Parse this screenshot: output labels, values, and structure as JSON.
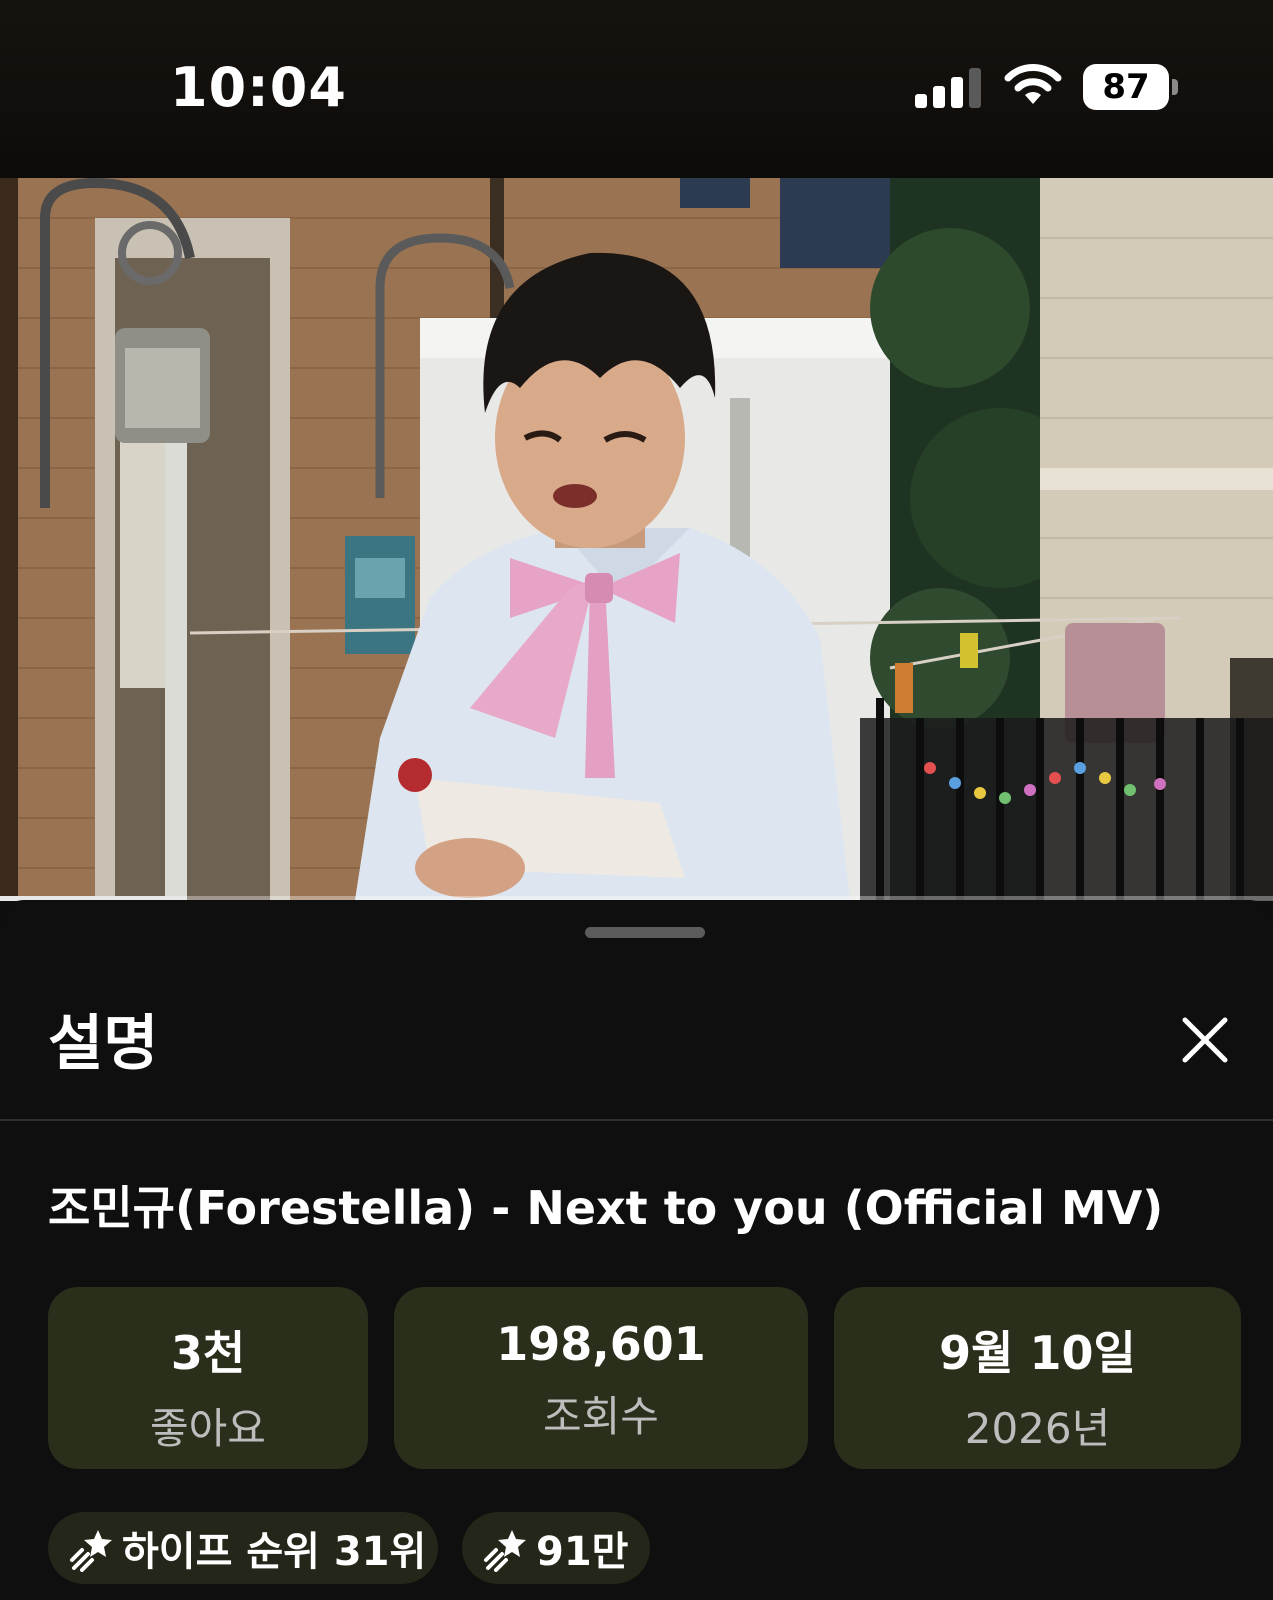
{
  "status_bar": {
    "time": "10:04",
    "battery": "87",
    "icons": [
      "cellular-signal-icon",
      "wifi-icon",
      "battery-icon"
    ]
  },
  "player": {
    "progress": 0.145
  },
  "sheet": {
    "title": "설명",
    "close_icon": "close-icon"
  },
  "video": {
    "title": "조민규(Forestella) - Next to you (Official MV)"
  },
  "stats": [
    {
      "value": "3천",
      "label": "좋아요"
    },
    {
      "value": "198,601",
      "label": "조회수"
    },
    {
      "value": "9월 10일",
      "label": "2026년"
    }
  ],
  "chips": [
    {
      "icon": "hype-icon",
      "label": "하이프 순위 31위"
    },
    {
      "icon": "hype-icon",
      "label": "91만"
    }
  ],
  "colors": {
    "background": "#0f0f0f",
    "stat_card": "#2a2f1b",
    "chip": "#232618",
    "secondary_text": "#bdbdbd"
  }
}
